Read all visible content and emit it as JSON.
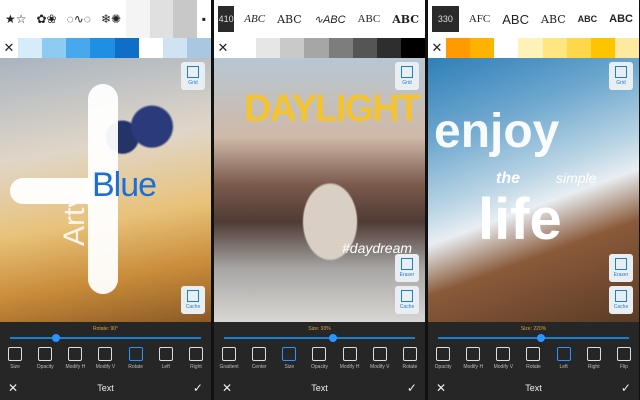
{
  "panels": [
    {
      "picker": {
        "glyphs": [
          "★☆",
          "✿❀",
          "◌∿◌",
          "❄✺",
          "▪"
        ]
      },
      "image_text": {
        "big": "Blue",
        "vertical": "Arty"
      },
      "buttons": {
        "grid": "Grid",
        "cache": "Cache"
      },
      "slider": {
        "label": "Rotate: 90°",
        "value": 0.22
      },
      "tools": [
        "Size",
        "Opacity",
        "Modify H",
        "Modify V",
        "Rotate",
        "Left",
        "Right"
      ],
      "active_tool": 4,
      "title": "Text"
    },
    {
      "picker": {
        "number": "410",
        "fonts": [
          "ABC",
          "ABC",
          "∿ABC",
          "ABC",
          "ABC"
        ]
      },
      "image_text": {
        "big": "DAYLIGHT",
        "tag": "#daydream"
      },
      "buttons": {
        "grid": "Grid",
        "eraser": "Eraser",
        "cache": "Cache"
      },
      "slider": {
        "label": "Size: 93%",
        "value": 0.55
      },
      "tools": [
        "Gradient",
        "Center",
        "Size",
        "Opacity",
        "Modify H",
        "Modify V",
        "Rotate"
      ],
      "active_tool": 2,
      "title": "Text"
    },
    {
      "picker": {
        "number": "330",
        "fonts": [
          "AFC",
          "ABC",
          "ABC",
          "ABC",
          "ABC"
        ]
      },
      "image_text": {
        "line1": "enjoy",
        "line2": "the",
        "line3": "simple",
        "line4": "life"
      },
      "buttons": {
        "grid": "Grid",
        "eraser": "Eraser",
        "cache": "Cache"
      },
      "slider": {
        "label": "Size: 220%",
        "value": 0.52
      },
      "tools": [
        "Opacity",
        "Modify H",
        "Modify V",
        "Rotate",
        "Left",
        "Right",
        "Flip"
      ],
      "active_tool": 4,
      "title": "Text"
    }
  ]
}
